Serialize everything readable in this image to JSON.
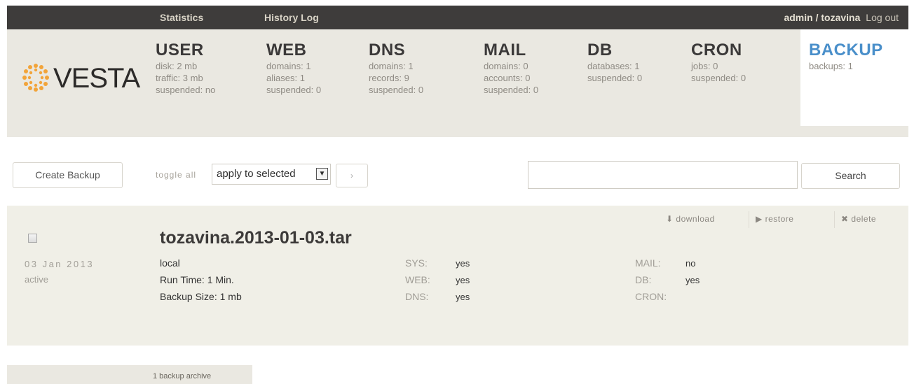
{
  "topbar": {
    "nav": [
      "Statistics",
      "History Log"
    ],
    "user": "admin / tozavina",
    "logout": "Log out"
  },
  "logo": {
    "text": "VESTA"
  },
  "menu": [
    {
      "title": "USER",
      "stats": [
        "disk: 2 mb",
        "traffic: 3 mb",
        "suspended: no"
      ]
    },
    {
      "title": "WEB",
      "stats": [
        "domains: 1",
        "aliases: 1",
        "suspended: 0"
      ]
    },
    {
      "title": "DNS",
      "stats": [
        "domains: 1",
        "records: 9",
        "suspended: 0"
      ]
    },
    {
      "title": "MAIL",
      "stats": [
        "domains: 0",
        "accounts: 0",
        "suspended: 0"
      ]
    },
    {
      "title": "DB",
      "stats": [
        "databases: 1",
        "suspended: 0"
      ]
    },
    {
      "title": "CRON",
      "stats": [
        "jobs: 0",
        "suspended: 0"
      ]
    },
    {
      "title": "BACKUP",
      "stats": [
        "backups: 1"
      ]
    }
  ],
  "toolbar": {
    "create_label": "Create Backup",
    "toggle_all": "toggle all",
    "select_value": "apply to selected",
    "go_label": "›",
    "search_value": "",
    "search_label": "Search"
  },
  "backup": {
    "title": "tozavina.2013-01-03.tar",
    "date": "03 Jan 2013",
    "status": "active",
    "type": "local",
    "run_time": "Run Time: 1 Min.",
    "size": "Backup Size: 1 mb",
    "actions": {
      "download": "download",
      "restore": "restore",
      "delete": "delete"
    },
    "fields": [
      {
        "label": "SYS:",
        "value": "yes"
      },
      {
        "label": "WEB:",
        "value": "yes"
      },
      {
        "label": "DNS:",
        "value": "yes"
      },
      {
        "label": "MAIL:",
        "value": "no"
      },
      {
        "label": "DB:",
        "value": "yes"
      },
      {
        "label": "CRON:",
        "value": ""
      }
    ]
  },
  "footer": {
    "count": "1 backup archive"
  },
  "colors": {
    "topbar": "#3e3c3b",
    "panel": "#eae8e1",
    "accent": "#4a8fca",
    "logo": "#f2a43a"
  }
}
